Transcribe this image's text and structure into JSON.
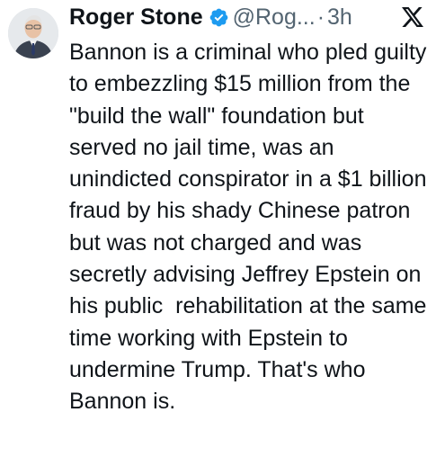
{
  "tweet": {
    "author_name": "Roger Stone",
    "handle": "@Rog...",
    "separator": "·",
    "time": "3h",
    "text": "Bannon is a criminal who pled guilty to embezzling $15 million from the \"build the wall\" foundation but served no jail time, was an unindicted conspirator in a $1 billion fraud by his shady Chinese patron but was not charged and was secretly advising Jeffrey Epstein on his public  rehabilitation at the same time working with Epstein to undermine Trump. That's who Bannon is.",
    "verified": true
  },
  "icons": {
    "avatar": "avatar",
    "verified": "verified-badge-icon",
    "platform": "x-logo-icon"
  },
  "colors": {
    "text": "#0f1419",
    "secondary": "#536471",
    "verified": "#1d9bf0",
    "background": "#ffffff"
  }
}
